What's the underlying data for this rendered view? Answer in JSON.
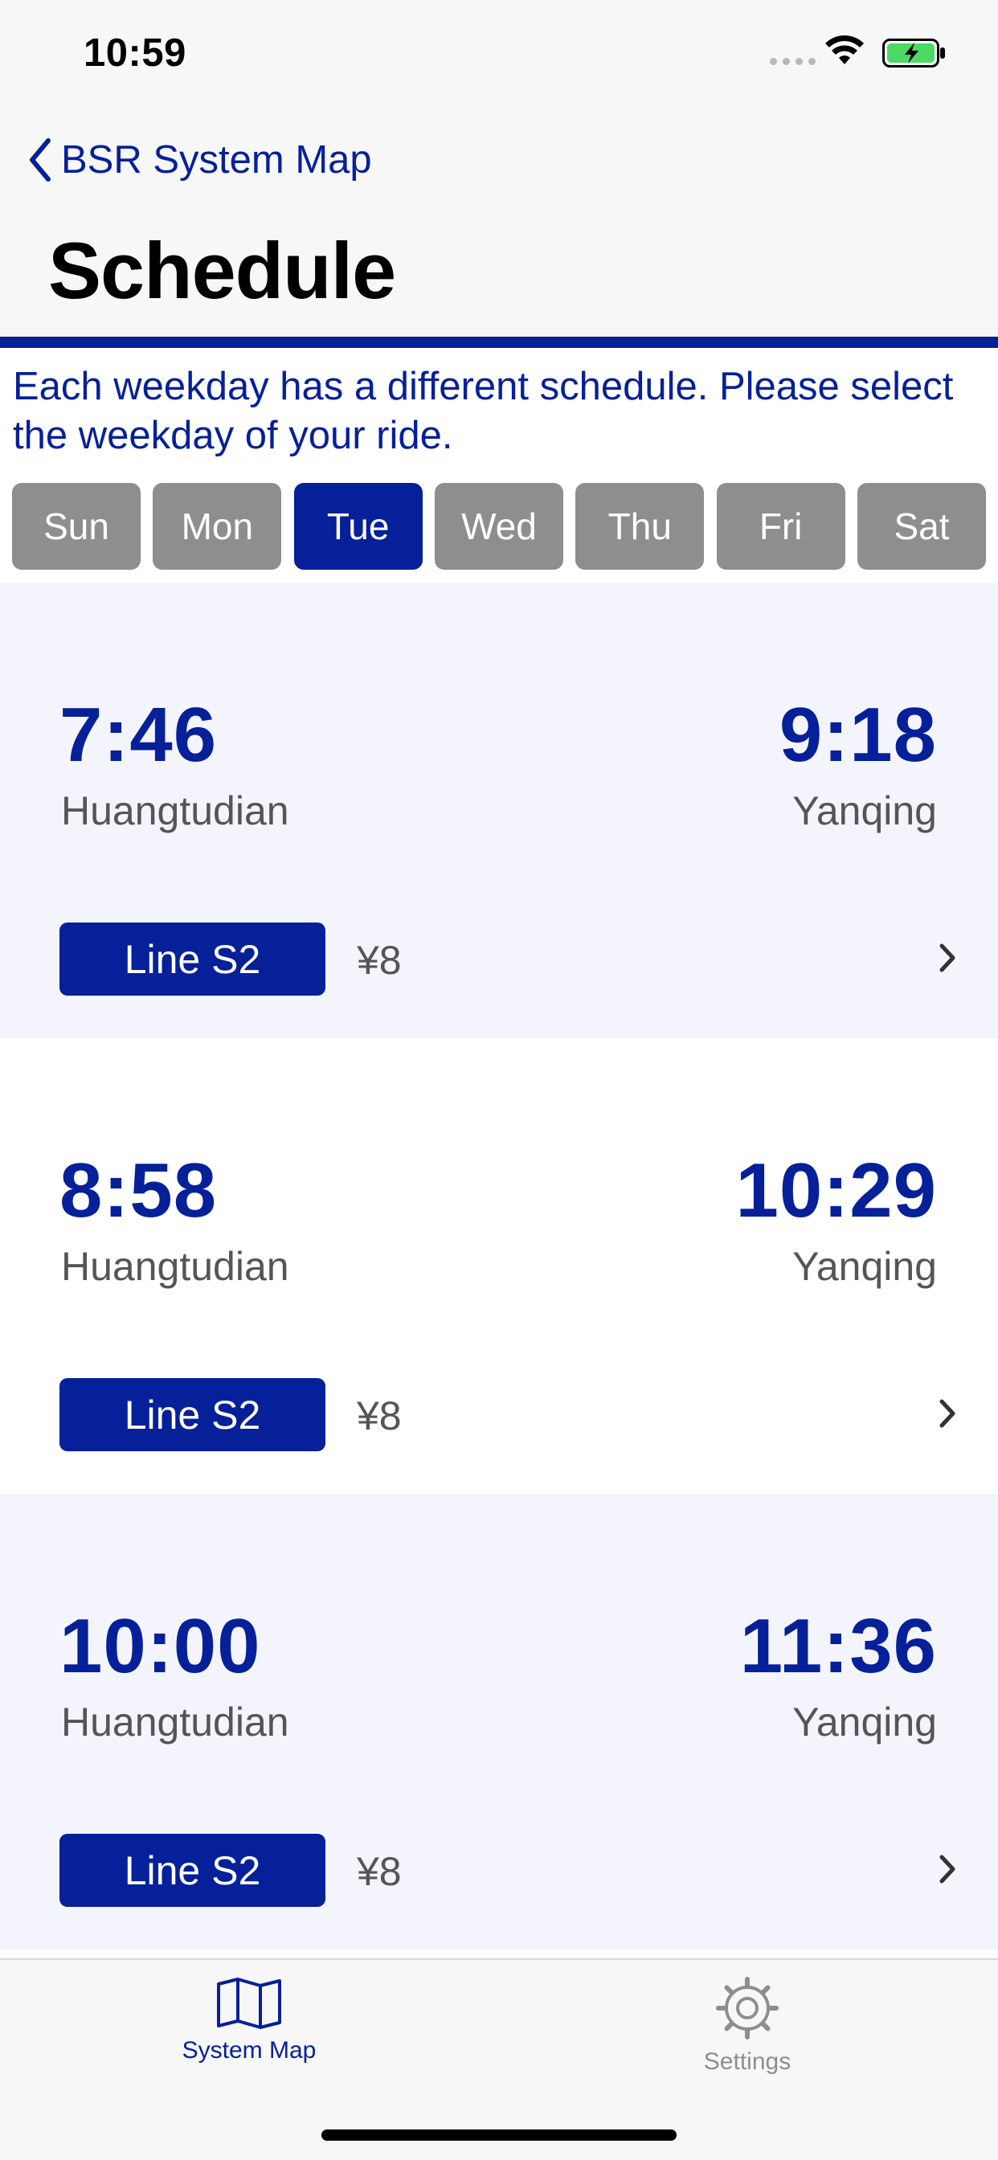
{
  "status_bar": {
    "time": "10:59"
  },
  "nav": {
    "back_label": "BSR System Map",
    "title": "Schedule"
  },
  "weekday": {
    "hint": "Each weekday has a different schedule. Please select the weekday of your ride.",
    "days": [
      "Sun",
      "Mon",
      "Tue",
      "Wed",
      "Thu",
      "Fri",
      "Sat"
    ],
    "selected": "Tue"
  },
  "trips": [
    {
      "depart_time": "7:46",
      "depart_station": "Huangtudian",
      "arrive_time": "9:18",
      "arrive_station": "Yanqing",
      "line": "Line S2",
      "fare": "¥8"
    },
    {
      "depart_time": "8:58",
      "depart_station": "Huangtudian",
      "arrive_time": "10:29",
      "arrive_station": "Yanqing",
      "line": "Line S2",
      "fare": "¥8"
    },
    {
      "depart_time": "10:00",
      "depart_station": "Huangtudian",
      "arrive_time": "11:36",
      "arrive_station": "Yanqing",
      "line": "Line S2",
      "fare": "¥8"
    }
  ],
  "tab_bar": {
    "items": [
      {
        "label": "System Map",
        "icon": "map-icon",
        "active": true
      },
      {
        "label": "Settings",
        "icon": "gear-icon",
        "active": false
      }
    ]
  },
  "colors": {
    "accent": "#06209a",
    "inactive_day": "#8e8e8e",
    "battery": "#4cd964"
  }
}
